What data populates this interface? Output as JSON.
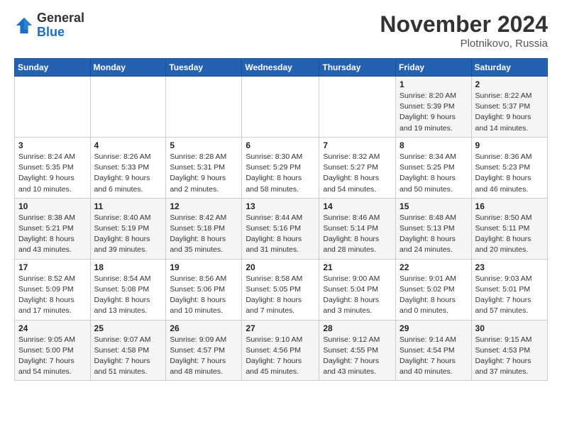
{
  "header": {
    "logo_general": "General",
    "logo_blue": "Blue",
    "month_title": "November 2024",
    "location": "Plotnikovo, Russia"
  },
  "weekdays": [
    "Sunday",
    "Monday",
    "Tuesday",
    "Wednesday",
    "Thursday",
    "Friday",
    "Saturday"
  ],
  "weeks": [
    [
      {
        "day": "",
        "info": ""
      },
      {
        "day": "",
        "info": ""
      },
      {
        "day": "",
        "info": ""
      },
      {
        "day": "",
        "info": ""
      },
      {
        "day": "",
        "info": ""
      },
      {
        "day": "1",
        "info": "Sunrise: 8:20 AM\nSunset: 5:39 PM\nDaylight: 9 hours and 19 minutes."
      },
      {
        "day": "2",
        "info": "Sunrise: 8:22 AM\nSunset: 5:37 PM\nDaylight: 9 hours and 14 minutes."
      }
    ],
    [
      {
        "day": "3",
        "info": "Sunrise: 8:24 AM\nSunset: 5:35 PM\nDaylight: 9 hours and 10 minutes."
      },
      {
        "day": "4",
        "info": "Sunrise: 8:26 AM\nSunset: 5:33 PM\nDaylight: 9 hours and 6 minutes."
      },
      {
        "day": "5",
        "info": "Sunrise: 8:28 AM\nSunset: 5:31 PM\nDaylight: 9 hours and 2 minutes."
      },
      {
        "day": "6",
        "info": "Sunrise: 8:30 AM\nSunset: 5:29 PM\nDaylight: 8 hours and 58 minutes."
      },
      {
        "day": "7",
        "info": "Sunrise: 8:32 AM\nSunset: 5:27 PM\nDaylight: 8 hours and 54 minutes."
      },
      {
        "day": "8",
        "info": "Sunrise: 8:34 AM\nSunset: 5:25 PM\nDaylight: 8 hours and 50 minutes."
      },
      {
        "day": "9",
        "info": "Sunrise: 8:36 AM\nSunset: 5:23 PM\nDaylight: 8 hours and 46 minutes."
      }
    ],
    [
      {
        "day": "10",
        "info": "Sunrise: 8:38 AM\nSunset: 5:21 PM\nDaylight: 8 hours and 43 minutes."
      },
      {
        "day": "11",
        "info": "Sunrise: 8:40 AM\nSunset: 5:19 PM\nDaylight: 8 hours and 39 minutes."
      },
      {
        "day": "12",
        "info": "Sunrise: 8:42 AM\nSunset: 5:18 PM\nDaylight: 8 hours and 35 minutes."
      },
      {
        "day": "13",
        "info": "Sunrise: 8:44 AM\nSunset: 5:16 PM\nDaylight: 8 hours and 31 minutes."
      },
      {
        "day": "14",
        "info": "Sunrise: 8:46 AM\nSunset: 5:14 PM\nDaylight: 8 hours and 28 minutes."
      },
      {
        "day": "15",
        "info": "Sunrise: 8:48 AM\nSunset: 5:13 PM\nDaylight: 8 hours and 24 minutes."
      },
      {
        "day": "16",
        "info": "Sunrise: 8:50 AM\nSunset: 5:11 PM\nDaylight: 8 hours and 20 minutes."
      }
    ],
    [
      {
        "day": "17",
        "info": "Sunrise: 8:52 AM\nSunset: 5:09 PM\nDaylight: 8 hours and 17 minutes."
      },
      {
        "day": "18",
        "info": "Sunrise: 8:54 AM\nSunset: 5:08 PM\nDaylight: 8 hours and 13 minutes."
      },
      {
        "day": "19",
        "info": "Sunrise: 8:56 AM\nSunset: 5:06 PM\nDaylight: 8 hours and 10 minutes."
      },
      {
        "day": "20",
        "info": "Sunrise: 8:58 AM\nSunset: 5:05 PM\nDaylight: 8 hours and 7 minutes."
      },
      {
        "day": "21",
        "info": "Sunrise: 9:00 AM\nSunset: 5:04 PM\nDaylight: 8 hours and 3 minutes."
      },
      {
        "day": "22",
        "info": "Sunrise: 9:01 AM\nSunset: 5:02 PM\nDaylight: 8 hours and 0 minutes."
      },
      {
        "day": "23",
        "info": "Sunrise: 9:03 AM\nSunset: 5:01 PM\nDaylight: 7 hours and 57 minutes."
      }
    ],
    [
      {
        "day": "24",
        "info": "Sunrise: 9:05 AM\nSunset: 5:00 PM\nDaylight: 7 hours and 54 minutes."
      },
      {
        "day": "25",
        "info": "Sunrise: 9:07 AM\nSunset: 4:58 PM\nDaylight: 7 hours and 51 minutes."
      },
      {
        "day": "26",
        "info": "Sunrise: 9:09 AM\nSunset: 4:57 PM\nDaylight: 7 hours and 48 minutes."
      },
      {
        "day": "27",
        "info": "Sunrise: 9:10 AM\nSunset: 4:56 PM\nDaylight: 7 hours and 45 minutes."
      },
      {
        "day": "28",
        "info": "Sunrise: 9:12 AM\nSunset: 4:55 PM\nDaylight: 7 hours and 43 minutes."
      },
      {
        "day": "29",
        "info": "Sunrise: 9:14 AM\nSunset: 4:54 PM\nDaylight: 7 hours and 40 minutes."
      },
      {
        "day": "30",
        "info": "Sunrise: 9:15 AM\nSunset: 4:53 PM\nDaylight: 7 hours and 37 minutes."
      }
    ]
  ]
}
